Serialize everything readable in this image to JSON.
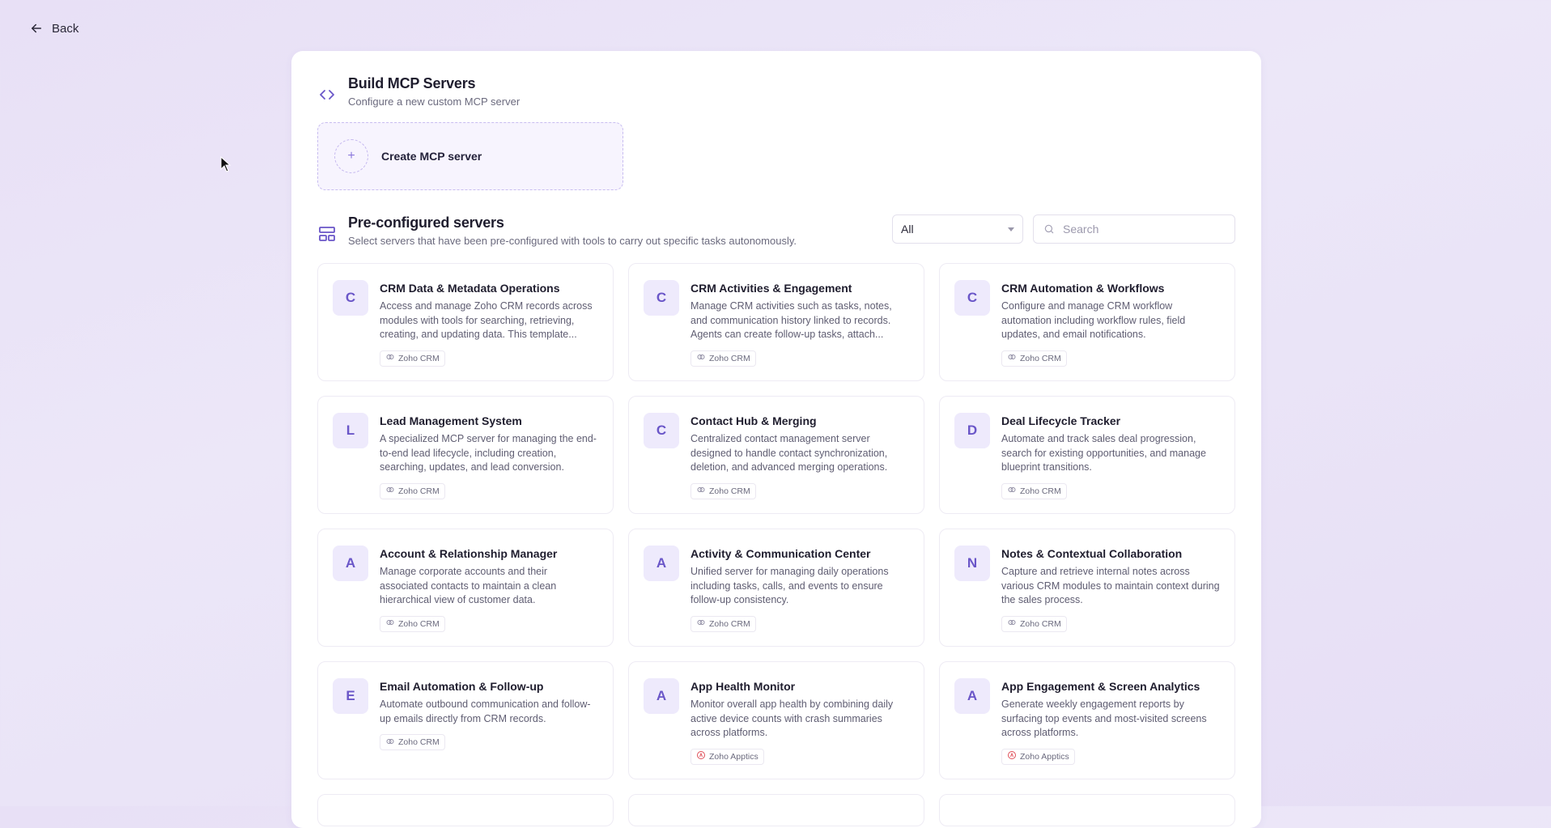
{
  "nav": {
    "back_label": "Back"
  },
  "build": {
    "title": "Build MCP Servers",
    "subtitle": "Configure a new custom MCP server",
    "create_label": "Create MCP server",
    "create_icon": "+"
  },
  "preconfigured": {
    "title": "Pre-configured servers",
    "subtitle": "Select servers that have been pre-configured with tools to carry out specific tasks autonomously.",
    "filter_value": "All",
    "search_placeholder": "Search"
  },
  "servers": [
    {
      "initial": "C",
      "title": "CRM Data & Metadata Operations",
      "description": "Access and manage Zoho CRM records across modules with tools for searching, retrieving, creating, and updating data. This template...",
      "tag": "Zoho CRM",
      "tag_icon": "link-icon"
    },
    {
      "initial": "C",
      "title": "CRM Activities & Engagement",
      "description": "Manage CRM activities such as tasks, notes, and communication history linked to records. Agents can create follow-up tasks, attach...",
      "tag": "Zoho CRM",
      "tag_icon": "link-icon"
    },
    {
      "initial": "C",
      "title": "CRM Automation & Workflows",
      "description": "Configure and manage CRM workflow automation including workflow rules, field updates, and email notifications.",
      "tag": "Zoho CRM",
      "tag_icon": "link-icon"
    },
    {
      "initial": "L",
      "title": "Lead Management System",
      "description": "A specialized MCP server for managing the end-to-end lead lifecycle, including creation, searching, updates, and lead conversion.",
      "tag": "Zoho CRM",
      "tag_icon": "link-icon"
    },
    {
      "initial": "C",
      "title": "Contact Hub & Merging",
      "description": "Centralized contact management server designed to handle contact synchronization, deletion, and advanced merging operations.",
      "tag": "Zoho CRM",
      "tag_icon": "link-icon"
    },
    {
      "initial": "D",
      "title": "Deal Lifecycle Tracker",
      "description": "Automate and track sales deal progression, search for existing opportunities, and manage blueprint transitions.",
      "tag": "Zoho CRM",
      "tag_icon": "link-icon"
    },
    {
      "initial": "A",
      "title": "Account & Relationship Manager",
      "description": "Manage corporate accounts and their associated contacts to maintain a clean hierarchical view of customer data.",
      "tag": "Zoho CRM",
      "tag_icon": "link-icon"
    },
    {
      "initial": "A",
      "title": "Activity & Communication Center",
      "description": "Unified server for managing daily operations including tasks, calls, and events to ensure follow-up consistency.",
      "tag": "Zoho CRM",
      "tag_icon": "link-icon"
    },
    {
      "initial": "N",
      "title": "Notes & Contextual Collaboration",
      "description": "Capture and retrieve internal notes across various CRM modules to maintain context during the sales process.",
      "tag": "Zoho CRM",
      "tag_icon": "link-icon"
    },
    {
      "initial": "E",
      "title": "Email Automation & Follow-up",
      "description": "Automate outbound communication and follow-up emails directly from CRM records.",
      "tag": "Zoho CRM",
      "tag_icon": "link-icon"
    },
    {
      "initial": "A",
      "title": "App Health Monitor",
      "description": "Monitor overall app health by combining daily active device counts with crash summaries across platforms.",
      "tag": "Zoho Apptics",
      "tag_icon": "apptics-icon"
    },
    {
      "initial": "A",
      "title": "App Engagement & Screen Analytics",
      "description": "Generate weekly engagement reports by surfacing top events and most-visited screens across platforms.",
      "tag": "Zoho Apptics",
      "tag_icon": "apptics-icon"
    }
  ],
  "colors": {
    "accent": "#6a56c8",
    "apptics": "#e0505a"
  }
}
